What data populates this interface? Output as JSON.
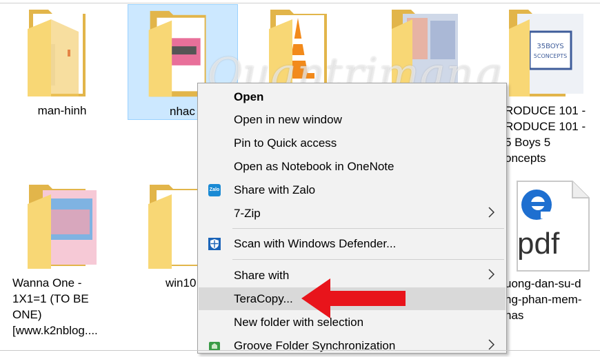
{
  "files": [
    {
      "label": "man-hinh",
      "type": "folder"
    },
    {
      "label": "nhac",
      "type": "folder",
      "selected": true
    },
    {
      "label": "",
      "type": "folder"
    },
    {
      "label": "",
      "type": "folder"
    },
    {
      "label_lines": [
        "RODUCE 101 -",
        "RODUCE 101 -",
        "5 Boys 5",
        "oncepts"
      ],
      "type": "folder"
    },
    {
      "label_lines": [
        "Wanna One -",
        "1X1=1 (TO BE",
        "ONE)",
        "[www.k2nblog...."
      ],
      "type": "folder"
    },
    {
      "label": "win10",
      "type": "folder"
    },
    {
      "label_lines": [
        "uong-dan-su-d",
        "ng-phan-mem-",
        "nas"
      ],
      "type": "pdf",
      "pdf_text": "pdf"
    }
  ],
  "watermark": "Quantrimang",
  "context_menu": {
    "items": [
      {
        "label": "Open",
        "bold": true
      },
      {
        "label": "Open in new window"
      },
      {
        "label": "Pin to Quick access"
      },
      {
        "label": "Open as Notebook in OneNote"
      },
      {
        "label": "Share with Zalo",
        "icon": "zalo-icon",
        "icon_text": "Zalo"
      },
      {
        "label": "7-Zip",
        "submenu": true
      },
      {
        "label": "Scan with Windows Defender...",
        "icon": "windows-defender-icon"
      },
      {
        "label": "Share with",
        "submenu": true
      },
      {
        "label": "TeraCopy...",
        "highlighted": true
      },
      {
        "label": "New folder with selection"
      },
      {
        "label": "Groove Folder Synchronization",
        "icon": "groove-icon",
        "submenu": true
      }
    ]
  },
  "colors": {
    "selection_bg": "#cce8ff",
    "menu_bg": "#f2f2f2",
    "highlight_bg": "#d9d9d9",
    "annotation_arrow": "#e8141b",
    "folder": "#f8d775"
  }
}
